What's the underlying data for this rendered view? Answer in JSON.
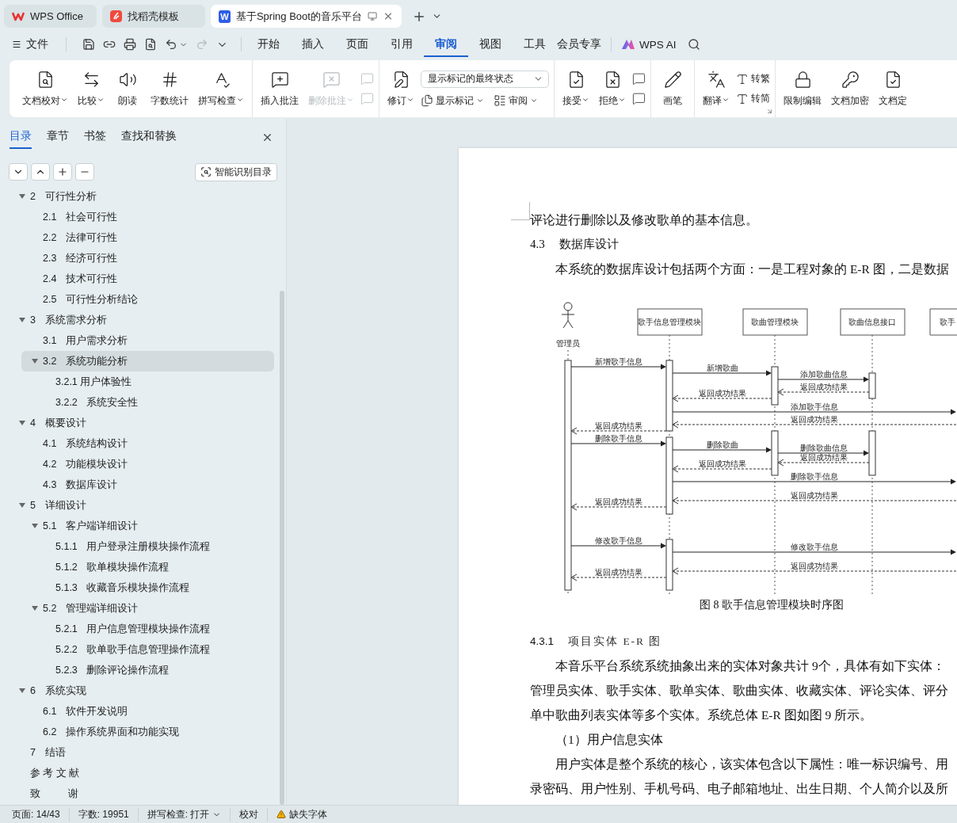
{
  "tabs": [
    {
      "kind": "home",
      "label": "WPS Office",
      "selected": false
    },
    {
      "kind": "template",
      "label": "找稻壳模板",
      "selected": false
    },
    {
      "kind": "doc",
      "icon_text": "W",
      "label": "基于Spring Boot的音乐平台",
      "selected": true
    }
  ],
  "menu": {
    "file": "文件",
    "quick_actions": [
      {
        "disabled": false
      },
      {
        "disabled": false
      },
      {
        "disabled": false
      },
      {
        "disabled": false
      },
      {
        "disabled": false
      },
      {
        "disabled": true
      }
    ],
    "tabs": [
      {
        "label": "开始",
        "selected": false
      },
      {
        "label": "插入",
        "selected": false
      },
      {
        "label": "页面",
        "selected": false
      },
      {
        "label": "引用",
        "selected": false
      },
      {
        "label": "审阅",
        "selected": true
      },
      {
        "label": "视图",
        "selected": false
      },
      {
        "label": "工具",
        "selected": false
      },
      {
        "label": "会员专享",
        "selected": false
      }
    ],
    "ai": "WPS AI"
  },
  "ribbon": [
    {
      "launcher": false,
      "items": [
        {
          "kind": "big",
          "label": "文档校对",
          "dropdown": true,
          "disabled": false
        },
        {
          "kind": "big",
          "label": "比较",
          "dropdown": true,
          "disabled": false
        },
        {
          "kind": "big",
          "label": "朗读",
          "dropdown": false,
          "disabled": false
        },
        {
          "kind": "big",
          "label": "字数统计",
          "dropdown": false,
          "disabled": false
        },
        {
          "kind": "big",
          "label": "拼写检查",
          "dropdown": true,
          "disabled": false
        }
      ]
    },
    {
      "launcher": false,
      "items": [
        {
          "kind": "big",
          "label": "插入批注",
          "dropdown": false,
          "disabled": false
        },
        {
          "kind": "big",
          "label": "删除批注",
          "dropdown": true,
          "disabled": true
        },
        {
          "kind": "stack",
          "rows": [
            [
              {
                "kind": "icon",
                "disabled": true
              }
            ],
            [
              {
                "kind": "icon",
                "disabled": true
              }
            ]
          ]
        }
      ]
    },
    {
      "launcher": false,
      "items": [
        {
          "kind": "big",
          "label": "修订",
          "dropdown": true,
          "disabled": false
        },
        {
          "kind": "stack",
          "rows": [
            [
              {
                "kind": "select",
                "value": "显示标记的最终状态"
              }
            ],
            [
              {
                "kind": "small",
                "label": "显示标记",
                "dropdown": true,
                "disabled": false
              },
              {
                "kind": "small",
                "label": "审阅",
                "dropdown": true,
                "disabled": false
              }
            ]
          ]
        }
      ]
    },
    {
      "launcher": false,
      "items": [
        {
          "kind": "big",
          "label": "接受",
          "dropdown": true,
          "disabled": false
        },
        {
          "kind": "big",
          "label": "拒绝",
          "dropdown": true,
          "disabled": false
        },
        {
          "kind": "stack",
          "rows": [
            [
              {
                "kind": "icon",
                "disabled": false
              }
            ],
            [
              {
                "kind": "icon",
                "disabled": false
              }
            ]
          ]
        }
      ]
    },
    {
      "launcher": false,
      "items": [
        {
          "kind": "big",
          "label": "画笔",
          "dropdown": false,
          "disabled": false
        }
      ]
    },
    {
      "launcher": true,
      "items": [
        {
          "kind": "big",
          "label": "翻译",
          "dropdown": true,
          "disabled": false
        },
        {
          "kind": "stack",
          "rows": [
            [
              {
                "kind": "small",
                "label": "转繁",
                "dropdown": false,
                "disabled": false
              }
            ],
            [
              {
                "kind": "small",
                "label": "转简",
                "dropdown": false,
                "disabled": false
              }
            ]
          ]
        }
      ]
    },
    {
      "items": [
        {
          "kind": "big",
          "label": "限制编辑",
          "dropdown": false,
          "disabled": false
        },
        {
          "kind": "big",
          "label": "文档加密",
          "dropdown": false,
          "disabled": false
        },
        {
          "kind": "big",
          "label": "文档定",
          "dropdown": false,
          "disabled": false
        }
      ]
    }
  ],
  "sidebar": {
    "tabs": [
      {
        "label": "目录",
        "selected": true
      },
      {
        "label": "章节",
        "selected": false
      },
      {
        "label": "书签",
        "selected": false
      },
      {
        "label": "查找和替换",
        "selected": false
      }
    ],
    "smart_button": "智能识别目录",
    "toc": [
      {
        "num": "2",
        "label": "可行性分析",
        "expanded": true,
        "selected": false,
        "children": [
          {
            "num": "2.1",
            "label": "社会可行性",
            "selected": false
          },
          {
            "num": "2.2",
            "label": "法律可行性",
            "selected": false
          },
          {
            "num": "2.3",
            "label": "经济可行性",
            "selected": false
          },
          {
            "num": "2.4",
            "label": "技术可行性",
            "selected": false
          },
          {
            "num": "2.5",
            "label": "可行性分析结论",
            "selected": false
          }
        ]
      },
      {
        "num": "3",
        "label": "系统需求分析",
        "expanded": true,
        "selected": false,
        "children": [
          {
            "num": "3.1",
            "label": "用户需求分析",
            "selected": false
          },
          {
            "num": "3.2",
            "label": "系统功能分析",
            "expanded": true,
            "selected": true,
            "children": [
              {
                "label": "3.2.1 用户体验性",
                "selected": false
              },
              {
                "num": "3.2.2",
                "label": "系统安全性",
                "selected": false
              }
            ]
          }
        ]
      },
      {
        "num": "4",
        "label": "概要设计",
        "expanded": true,
        "selected": false,
        "children": [
          {
            "num": "4.1",
            "label": "系统结构设计",
            "selected": false
          },
          {
            "num": "4.2",
            "label": "功能模块设计",
            "selected": false
          },
          {
            "num": "4.3",
            "label": "数据库设计",
            "selected": false
          }
        ]
      },
      {
        "num": "5",
        "label": "详细设计",
        "expanded": true,
        "selected": false,
        "children": [
          {
            "num": "5.1",
            "label": "客户端详细设计",
            "expanded": true,
            "selected": false,
            "children": [
              {
                "num": "5.1.1",
                "label": "用户登录注册模块操作流程",
                "selected": false
              },
              {
                "num": "5.1.2",
                "label": "歌单模块操作流程",
                "selected": false
              },
              {
                "num": "5.1.3",
                "label": "收藏音乐模块操作流程",
                "selected": false
              }
            ]
          },
          {
            "num": "5.2",
            "label": "管理端详细设计",
            "expanded": true,
            "selected": false,
            "children": [
              {
                "num": "5.2.1",
                "label": "用户信息管理模块操作流程",
                "selected": false
              },
              {
                "num": "5.2.2",
                "label": "歌单歌手信息管理操作流程",
                "selected": false
              },
              {
                "num": "5.2.3",
                "label": "删除评论操作流程",
                "selected": false
              }
            ]
          }
        ]
      },
      {
        "num": "6",
        "label": "系统实现",
        "expanded": true,
        "selected": false,
        "children": [
          {
            "num": "6.1",
            "label": "软件开发说明",
            "selected": false
          },
          {
            "num": "6.2",
            "label": "操作系统界面和功能实现",
            "selected": false
          }
        ]
      },
      {
        "num": "7",
        "label": "结语",
        "selected": false
      },
      {
        "label": "参 考 文 献",
        "selected": false
      },
      {
        "label": "致          谢",
        "selected": false
      }
    ]
  },
  "document": [
    {
      "kind": "para",
      "indent": false,
      "text": "评论进行删除以及修改歌单的基本信息。"
    },
    {
      "kind": "heading",
      "num": "4.3",
      "text": "数据库设计"
    },
    {
      "kind": "para",
      "indent": true,
      "text": "本系统的数据库设计包括两个方面：一是工程对象的 E-R 图，二是数据"
    },
    {
      "kind": "figure",
      "caption": "图 8  歌手信息管理模块时序图",
      "diagram": {
        "participants": [
          {
            "kind": "actor",
            "label": "管理员"
          },
          {
            "kind": "box",
            "label": "歌手信息管理模块"
          },
          {
            "kind": "box",
            "label": "歌曲管理模块"
          },
          {
            "kind": "box",
            "label": "歌曲信息接口"
          },
          {
            "kind": "box",
            "label": "歌手"
          }
        ],
        "messages": [
          {
            "kind": "call",
            "label": "新增歌手信息"
          },
          {
            "kind": "call",
            "label": "新增歌曲"
          },
          {
            "kind": "call",
            "label": "添加歌曲信息"
          },
          {
            "kind": "return",
            "label": "返回成功结果"
          },
          {
            "kind": "return",
            "label": "返回成功结果"
          },
          {
            "kind": "call",
            "label": "添加歌手信息"
          },
          {
            "kind": "return",
            "label": "返回成功结果"
          },
          {
            "kind": "return",
            "label": "返回成功结果"
          },
          {
            "kind": "call",
            "label": "删除歌手信息"
          },
          {
            "kind": "call",
            "label": "删除歌曲"
          },
          {
            "kind": "call",
            "label": "删除歌曲信息"
          },
          {
            "kind": "return",
            "label": "返回成功结果"
          },
          {
            "kind": "return",
            "label": "返回成功结果"
          },
          {
            "kind": "call",
            "label": "删除歌手信息"
          },
          {
            "kind": "return",
            "label": "返回成功结果"
          },
          {
            "kind": "return",
            "label": "返回成功结果"
          },
          {
            "kind": "call",
            "label": "修改歌手信息"
          },
          {
            "kind": "call",
            "label": "修改歌手信息"
          },
          {
            "kind": "return",
            "label": "返回成功结果"
          },
          {
            "kind": "return",
            "label": "返回成功结果"
          }
        ]
      }
    },
    {
      "kind": "subheading",
      "num": "4.3.1",
      "text": "项目实体 E-R 图"
    },
    {
      "kind": "para",
      "indent": true,
      "text": "本音乐平台系统系统抽象出来的实体对象共计 9个，具体有如下实体："
    },
    {
      "kind": "para",
      "indent": false,
      "text": "管理员实体、歌手实体、歌单实体、歌曲实体、收藏实体、评论实体、评分"
    },
    {
      "kind": "para",
      "indent": false,
      "text": "单中歌曲列表实体等多个实体。系统总体 E-R 图如图 9 所示。"
    },
    {
      "kind": "para",
      "indent": true,
      "text": "（1）用户信息实体"
    },
    {
      "kind": "para",
      "indent": true,
      "text": "用户实体是整个系统的核心，该实体包含以下属性：唯一标识编号、用"
    },
    {
      "kind": "para",
      "indent": false,
      "text": "录密码、用户性别、手机号码、电子邮箱地址、出生日期、个人简介以及所"
    }
  ],
  "status_bar": [
    {
      "kind": "text",
      "label": "页面: 14/43"
    },
    {
      "kind": "text",
      "label": "字数: 19951"
    },
    {
      "kind": "dropdown",
      "label": "拼写检查: 打开"
    },
    {
      "kind": "text",
      "label": "校对"
    },
    {
      "kind": "warning",
      "label": "缺失字体"
    }
  ]
}
